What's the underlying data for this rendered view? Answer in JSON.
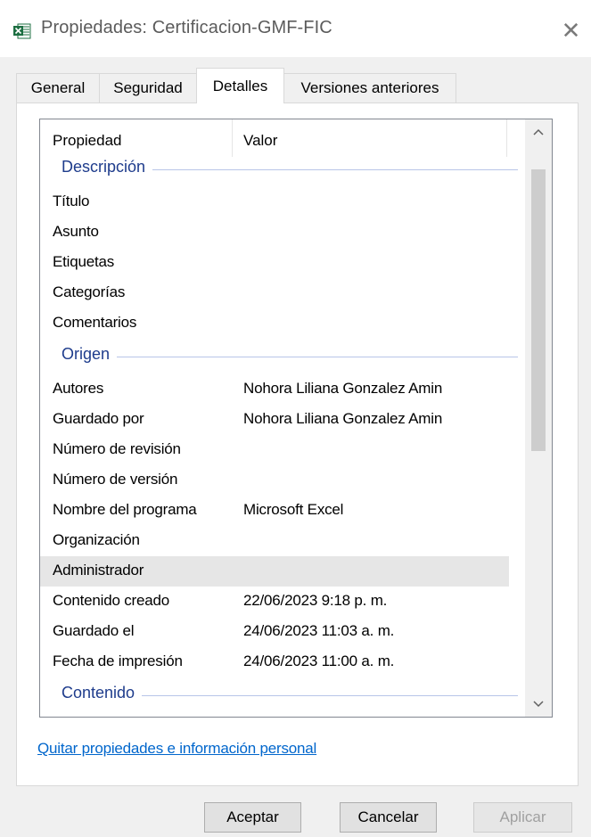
{
  "window": {
    "title": "Propiedades: Certificacion-GMF-FIC",
    "icon": "excel-file-icon",
    "close_label": "✕"
  },
  "tabs": [
    {
      "label": "General",
      "active": false
    },
    {
      "label": "Seguridad",
      "active": false
    },
    {
      "label": "Detalles",
      "active": true
    },
    {
      "label": "Versiones anteriores",
      "active": false
    }
  ],
  "list": {
    "columns": {
      "property": "Propiedad",
      "value": "Valor"
    },
    "groups": {
      "descripcion": "Descripción",
      "origen": "Origen",
      "contenido": "Contenido"
    },
    "rows": [
      {
        "property": "Título",
        "value": ""
      },
      {
        "property": "Asunto",
        "value": ""
      },
      {
        "property": "Etiquetas",
        "value": ""
      },
      {
        "property": "Categorías",
        "value": ""
      },
      {
        "property": "Comentarios",
        "value": ""
      },
      {
        "property": "Autores",
        "value": "Nohora Liliana Gonzalez Amin"
      },
      {
        "property": "Guardado por",
        "value": "Nohora Liliana Gonzalez Amin"
      },
      {
        "property": "Número de revisión",
        "value": ""
      },
      {
        "property": "Número de versión",
        "value": ""
      },
      {
        "property": "Nombre del programa",
        "value": "Microsoft Excel"
      },
      {
        "property": "Organización",
        "value": ""
      },
      {
        "property": "Administrador",
        "value": "",
        "selected": true
      },
      {
        "property": "Contenido creado",
        "value": "22/06/2023 9:18 p. m."
      },
      {
        "property": "Guardado el",
        "value": "24/06/2023 11:03 a. m."
      },
      {
        "property": "Fecha de impresión",
        "value": "24/06/2023 11:00 a. m."
      }
    ]
  },
  "scrollbar": {
    "up_icon": "chevron-up-icon",
    "down_icon": "chevron-down-icon"
  },
  "link": "Quitar propiedades e información personal",
  "buttons": {
    "ok": "Aceptar",
    "cancel": "Cancelar",
    "apply": "Aplicar",
    "apply_enabled": false
  },
  "colors": {
    "group_header": "#1e3c8c",
    "link": "#0066cc",
    "excel_green": "#1d6f42"
  }
}
